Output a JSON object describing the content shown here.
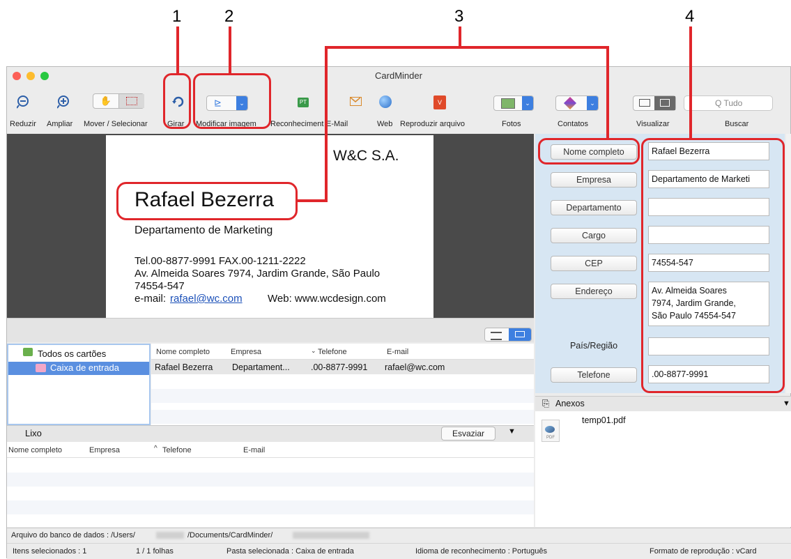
{
  "callouts": [
    "1",
    "2",
    "3",
    "4"
  ],
  "window": {
    "title": "CardMinder"
  },
  "toolbar": {
    "items": [
      {
        "label": "Reduzir",
        "icon": "zoom-out-icon"
      },
      {
        "label": "Ampliar",
        "icon": "zoom-in-icon"
      },
      {
        "label": "Mover / Selecionar",
        "icon": "hand-select-icon"
      },
      {
        "label": "Girar",
        "icon": "rotate-icon"
      },
      {
        "label": "Modificar imagem",
        "icon": "modify-image-icon"
      },
      {
        "label": "Reconhecimento",
        "icon": "recognition-icon"
      },
      {
        "label": "E-Mail",
        "icon": "mail-icon"
      },
      {
        "label": "Web",
        "icon": "web-icon"
      },
      {
        "label": "Reproduzir arquivo",
        "icon": "vcard-icon"
      },
      {
        "label": "Fotos",
        "icon": "photos-icon"
      },
      {
        "label": "Contatos",
        "icon": "contacts-icon"
      },
      {
        "label": "Visualizar",
        "icon": "view-icon"
      },
      {
        "label": "Buscar",
        "icon": "search-icon"
      }
    ],
    "search_placeholder": "Q Tudo"
  },
  "card": {
    "company": "W&C S.A.",
    "name": "Rafael Bezerra",
    "department": "Departamento de Marketing",
    "tel_line": "Tel.00-8877-9991   FAX.00-1211-2222",
    "address_line": "Av. Almeida Soares 7974, Jardim Grande, São Paulo",
    "zip_line": "74554-547",
    "email_label": "e-mail: ",
    "email": "rafael@wc.com",
    "web": "Web: www.wcdesign.com"
  },
  "fields": [
    {
      "label": "Nome completo",
      "value": "Rafael Bezerra",
      "button": true
    },
    {
      "label": "Empresa",
      "value": "Departamento de Marketi",
      "button": true
    },
    {
      "label": "Departamento",
      "value": "",
      "button": true
    },
    {
      "label": "Cargo",
      "value": "",
      "button": true
    },
    {
      "label": "CEP",
      "value": "74554-547",
      "button": true
    },
    {
      "label": "Endereço",
      "value": "Av. Almeida Soares\n7974, Jardim Grande,\nSão Paulo 74554-547",
      "button": true
    },
    {
      "label": "País/Região",
      "value": "",
      "button": false
    },
    {
      "label": "Telefone",
      "value": ".00-8877-9991",
      "button": true
    }
  ],
  "tree": {
    "all_cards": "Todos os cartões",
    "inbox": "Caixa de entrada"
  },
  "list": {
    "headers": [
      "Nome completo",
      "Empresa",
      "Telefone",
      "E-mail"
    ],
    "rows": [
      [
        "Rafael Bezerra",
        "Departament...",
        ".00-8877-9991",
        "rafael@wc.com"
      ]
    ]
  },
  "trash": {
    "title": "Lixo",
    "empty_button": "Esvaziar",
    "headers": [
      "Nome completo",
      "Empresa",
      "Telefone",
      "E-mail"
    ]
  },
  "attachments": {
    "title": "Anexos",
    "file": "temp01.pdf",
    "file_type": "PDF"
  },
  "db_path": {
    "prefix": "Arquivo do banco de dados : /Users/",
    "middle": "/Documents/CardMinder/"
  },
  "status": {
    "selected": "Itens selecionados : 1",
    "pages": "1 / 1 folhas",
    "folder": "Pasta selecionada : Caixa de entrada",
    "language": "Idioma de reconhecimento : Português",
    "format": "Formato de reprodução : vCard"
  },
  "colors": {
    "callout": "#e0262b",
    "accent": "#3d7fe0",
    "panel": "#d7e6f3",
    "selection": "#5a8fe0"
  }
}
